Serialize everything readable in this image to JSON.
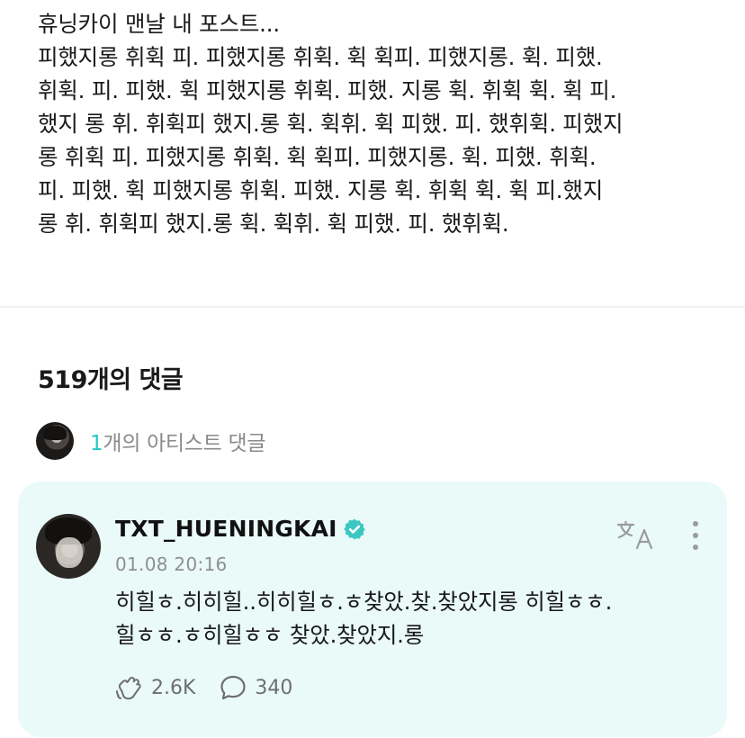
{
  "post": {
    "lines": [
      "휴닝카이 맨날 내 포스트...",
      "피했지롱 휘휙 피. 피했지롱 휘휙. 휙 휙피. 피했지롱. 휙. 피했.",
      "휘휙. 피. 피했. 휙 피했지롱 휘휙. 피했. 지롱 휙. 휘휙 휙. 휙 피.",
      "했지 롱 휘. 휘휙피 했지.롱 휙. 휙휘. 휙 피했. 피. 했휘휙. 피했지",
      "롱 휘휙 피. 피했지롱 휘휙. 휙 휙피. 피했지롱. 휙. 피했. 휘휙.",
      "피. 피했. 휙 피했지롱 휘휙. 피했. 지롱 휙. 휘휙 휙. 휙 피.했지",
      "롱 휘. 휘휙피 했지.롱 휙. 휙휘. 휙 피했. 피. 했휘휙."
    ]
  },
  "comments": {
    "heading": "519개의 댓글",
    "artist_summary": {
      "count": "1",
      "label": "개의 아티스트 댓글"
    },
    "items": [
      {
        "author": "TXT_HUENINGKAI",
        "timestamp": "01.08 20:16",
        "lines": [
          "히힐ㅎ.히히힐..히히힐ㅎ.ㅎ찾았.찾.찾았지롱 히힐ㅎㅎ.",
          "힐ㅎㅎ.ㅎ히힐ㅎㅎ 찾았.찾았지.롱"
        ],
        "likes": "2.6K",
        "replies": "340"
      }
    ]
  },
  "icons": {
    "verified": "verified-badge-icon",
    "translate": "translate-icon",
    "more": "more-vertical-icon",
    "like": "cheer-hand-icon",
    "reply": "comment-bubble-icon"
  },
  "colors": {
    "accent": "#24c7c3",
    "card_background": "#e9faf8",
    "muted_text": "#8e8e93"
  }
}
